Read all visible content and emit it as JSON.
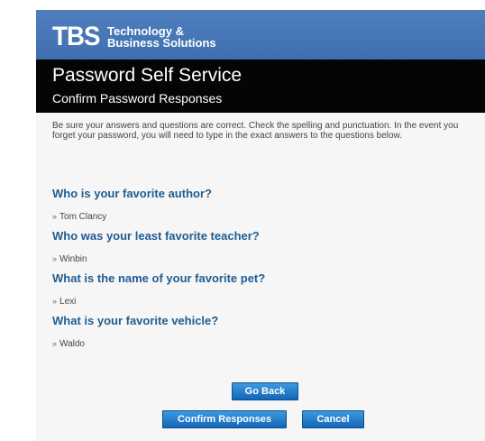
{
  "brand": {
    "abbr": "TBS",
    "line1": "Technology &",
    "line2": "Business Solutions"
  },
  "header": {
    "title": "Password Self Service",
    "subtitle": "Confirm Password Responses"
  },
  "intro": "Be sure your answers and questions are correct. Check the spelling and punctuation. In the event you forget your password, you will need to type in the exact answers to the questions below.",
  "qa": [
    {
      "question": "Who is your favorite author?",
      "answer": "Tom Clancy"
    },
    {
      "question": "Who was your least favorite teacher?",
      "answer": "Winbin"
    },
    {
      "question": "What is the name of your favorite pet?",
      "answer": "Lexi"
    },
    {
      "question": "What is your favorite vehicle?",
      "answer": "Waldo"
    }
  ],
  "bullet": "»",
  "buttons": {
    "go_back": "Go Back",
    "confirm": "Confirm Responses",
    "cancel": "Cancel"
  },
  "colors": {
    "brand_bar": "#4a7cbc",
    "title_bar": "#050505",
    "question_text": "#1f5d91",
    "button": "#1f78c8"
  }
}
